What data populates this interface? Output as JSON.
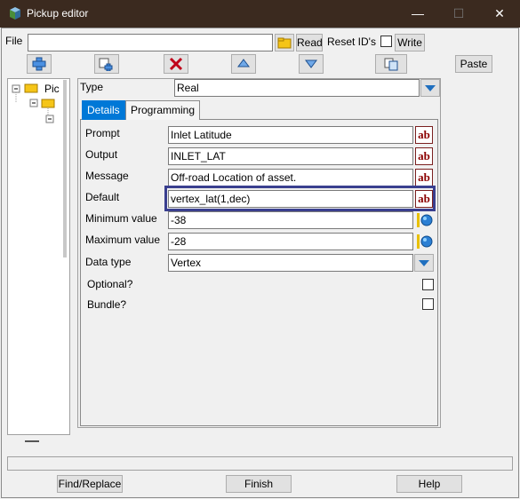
{
  "window": {
    "title": "Pickup editor",
    "minimize": "—",
    "maximize": "☐",
    "close": "✕"
  },
  "file_row": {
    "file_label": "File",
    "file_value": "",
    "read_label": "Read",
    "reset_ids_label": "Reset ID's",
    "write_label": "Write",
    "write_checked": false
  },
  "toolbar": {
    "paste_label": "Paste"
  },
  "tree": {
    "root_label": "Pic"
  },
  "type_row": {
    "label": "Type",
    "value": "Real"
  },
  "tabs": [
    {
      "label": "Details",
      "active": true
    },
    {
      "label": "Programming",
      "active": false
    }
  ],
  "fields": {
    "prompt": {
      "label": "Prompt",
      "value": "Inlet Latitude"
    },
    "output": {
      "label": "Output",
      "value": "INLET_LAT"
    },
    "message": {
      "label": "Message",
      "value": "Off-road Location of asset."
    },
    "default": {
      "label": "Default",
      "value": "vertex_lat(1,dec)"
    },
    "min": {
      "label": "Minimum value",
      "value": "-38"
    },
    "max": {
      "label": "Maximum value",
      "value": "-28"
    },
    "data_type": {
      "label": "Data type",
      "value": "Vertex"
    },
    "optional": {
      "label": "Optional?",
      "checked": false
    },
    "bundle": {
      "label": "Bundle?",
      "checked": false
    }
  },
  "ab_icon_text": "ab",
  "footer": {
    "find_replace": "Find/Replace",
    "finish": "Finish",
    "help": "Help"
  },
  "colors": {
    "titlebar": "#3b2a1f",
    "accent": "#0078d7",
    "highlight_border": "#3a3f8f",
    "ab_red": "#8b0000"
  }
}
